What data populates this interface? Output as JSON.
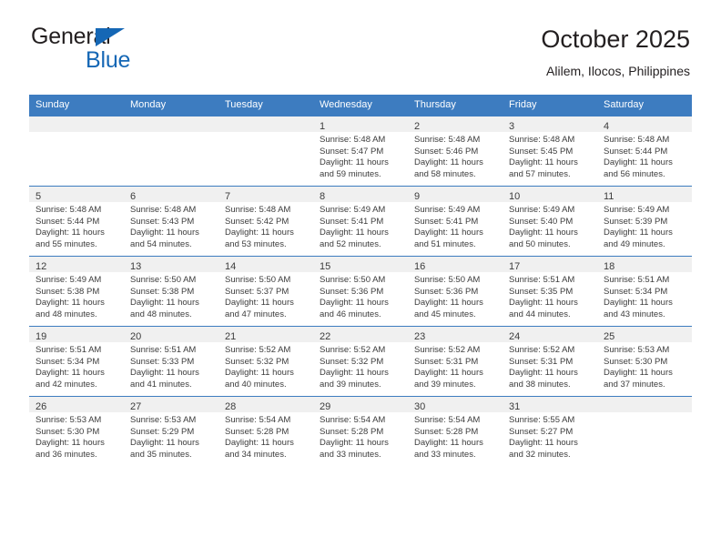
{
  "brand": {
    "name_part1": "General",
    "name_part2": "Blue",
    "triangle_color": "#1567b5"
  },
  "header": {
    "title": "October 2025",
    "subtitle": "Alilem, Ilocos, Philippines"
  },
  "theme": {
    "header_blue": "#3d7cc0",
    "daynum_band": "#f0f0f0",
    "text": "#3c3c3c"
  },
  "calendar": {
    "weekday_headers": [
      "Sunday",
      "Monday",
      "Tuesday",
      "Wednesday",
      "Thursday",
      "Friday",
      "Saturday"
    ],
    "weeks": [
      [
        {
          "day": "",
          "sunrise": "",
          "sunset": "",
          "daylight": "",
          "empty": true
        },
        {
          "day": "",
          "sunrise": "",
          "sunset": "",
          "daylight": "",
          "empty": true
        },
        {
          "day": "",
          "sunrise": "",
          "sunset": "",
          "daylight": "",
          "empty": true
        },
        {
          "day": "1",
          "sunrise": "Sunrise: 5:48 AM",
          "sunset": "Sunset: 5:47 PM",
          "daylight": "Daylight: 11 hours and 59 minutes.",
          "empty": false
        },
        {
          "day": "2",
          "sunrise": "Sunrise: 5:48 AM",
          "sunset": "Sunset: 5:46 PM",
          "daylight": "Daylight: 11 hours and 58 minutes.",
          "empty": false
        },
        {
          "day": "3",
          "sunrise": "Sunrise: 5:48 AM",
          "sunset": "Sunset: 5:45 PM",
          "daylight": "Daylight: 11 hours and 57 minutes.",
          "empty": false
        },
        {
          "day": "4",
          "sunrise": "Sunrise: 5:48 AM",
          "sunset": "Sunset: 5:44 PM",
          "daylight": "Daylight: 11 hours and 56 minutes.",
          "empty": false
        }
      ],
      [
        {
          "day": "5",
          "sunrise": "Sunrise: 5:48 AM",
          "sunset": "Sunset: 5:44 PM",
          "daylight": "Daylight: 11 hours and 55 minutes.",
          "empty": false
        },
        {
          "day": "6",
          "sunrise": "Sunrise: 5:48 AM",
          "sunset": "Sunset: 5:43 PM",
          "daylight": "Daylight: 11 hours and 54 minutes.",
          "empty": false
        },
        {
          "day": "7",
          "sunrise": "Sunrise: 5:48 AM",
          "sunset": "Sunset: 5:42 PM",
          "daylight": "Daylight: 11 hours and 53 minutes.",
          "empty": false
        },
        {
          "day": "8",
          "sunrise": "Sunrise: 5:49 AM",
          "sunset": "Sunset: 5:41 PM",
          "daylight": "Daylight: 11 hours and 52 minutes.",
          "empty": false
        },
        {
          "day": "9",
          "sunrise": "Sunrise: 5:49 AM",
          "sunset": "Sunset: 5:41 PM",
          "daylight": "Daylight: 11 hours and 51 minutes.",
          "empty": false
        },
        {
          "day": "10",
          "sunrise": "Sunrise: 5:49 AM",
          "sunset": "Sunset: 5:40 PM",
          "daylight": "Daylight: 11 hours and 50 minutes.",
          "empty": false
        },
        {
          "day": "11",
          "sunrise": "Sunrise: 5:49 AM",
          "sunset": "Sunset: 5:39 PM",
          "daylight": "Daylight: 11 hours and 49 minutes.",
          "empty": false
        }
      ],
      [
        {
          "day": "12",
          "sunrise": "Sunrise: 5:49 AM",
          "sunset": "Sunset: 5:38 PM",
          "daylight": "Daylight: 11 hours and 48 minutes.",
          "empty": false
        },
        {
          "day": "13",
          "sunrise": "Sunrise: 5:50 AM",
          "sunset": "Sunset: 5:38 PM",
          "daylight": "Daylight: 11 hours and 48 minutes.",
          "empty": false
        },
        {
          "day": "14",
          "sunrise": "Sunrise: 5:50 AM",
          "sunset": "Sunset: 5:37 PM",
          "daylight": "Daylight: 11 hours and 47 minutes.",
          "empty": false
        },
        {
          "day": "15",
          "sunrise": "Sunrise: 5:50 AM",
          "sunset": "Sunset: 5:36 PM",
          "daylight": "Daylight: 11 hours and 46 minutes.",
          "empty": false
        },
        {
          "day": "16",
          "sunrise": "Sunrise: 5:50 AM",
          "sunset": "Sunset: 5:36 PM",
          "daylight": "Daylight: 11 hours and 45 minutes.",
          "empty": false
        },
        {
          "day": "17",
          "sunrise": "Sunrise: 5:51 AM",
          "sunset": "Sunset: 5:35 PM",
          "daylight": "Daylight: 11 hours and 44 minutes.",
          "empty": false
        },
        {
          "day": "18",
          "sunrise": "Sunrise: 5:51 AM",
          "sunset": "Sunset: 5:34 PM",
          "daylight": "Daylight: 11 hours and 43 minutes.",
          "empty": false
        }
      ],
      [
        {
          "day": "19",
          "sunrise": "Sunrise: 5:51 AM",
          "sunset": "Sunset: 5:34 PM",
          "daylight": "Daylight: 11 hours and 42 minutes.",
          "empty": false
        },
        {
          "day": "20",
          "sunrise": "Sunrise: 5:51 AM",
          "sunset": "Sunset: 5:33 PM",
          "daylight": "Daylight: 11 hours and 41 minutes.",
          "empty": false
        },
        {
          "day": "21",
          "sunrise": "Sunrise: 5:52 AM",
          "sunset": "Sunset: 5:32 PM",
          "daylight": "Daylight: 11 hours and 40 minutes.",
          "empty": false
        },
        {
          "day": "22",
          "sunrise": "Sunrise: 5:52 AM",
          "sunset": "Sunset: 5:32 PM",
          "daylight": "Daylight: 11 hours and 39 minutes.",
          "empty": false
        },
        {
          "day": "23",
          "sunrise": "Sunrise: 5:52 AM",
          "sunset": "Sunset: 5:31 PM",
          "daylight": "Daylight: 11 hours and 39 minutes.",
          "empty": false
        },
        {
          "day": "24",
          "sunrise": "Sunrise: 5:52 AM",
          "sunset": "Sunset: 5:31 PM",
          "daylight": "Daylight: 11 hours and 38 minutes.",
          "empty": false
        },
        {
          "day": "25",
          "sunrise": "Sunrise: 5:53 AM",
          "sunset": "Sunset: 5:30 PM",
          "daylight": "Daylight: 11 hours and 37 minutes.",
          "empty": false
        }
      ],
      [
        {
          "day": "26",
          "sunrise": "Sunrise: 5:53 AM",
          "sunset": "Sunset: 5:30 PM",
          "daylight": "Daylight: 11 hours and 36 minutes.",
          "empty": false
        },
        {
          "day": "27",
          "sunrise": "Sunrise: 5:53 AM",
          "sunset": "Sunset: 5:29 PM",
          "daylight": "Daylight: 11 hours and 35 minutes.",
          "empty": false
        },
        {
          "day": "28",
          "sunrise": "Sunrise: 5:54 AM",
          "sunset": "Sunset: 5:28 PM",
          "daylight": "Daylight: 11 hours and 34 minutes.",
          "empty": false
        },
        {
          "day": "29",
          "sunrise": "Sunrise: 5:54 AM",
          "sunset": "Sunset: 5:28 PM",
          "daylight": "Daylight: 11 hours and 33 minutes.",
          "empty": false
        },
        {
          "day": "30",
          "sunrise": "Sunrise: 5:54 AM",
          "sunset": "Sunset: 5:28 PM",
          "daylight": "Daylight: 11 hours and 33 minutes.",
          "empty": false
        },
        {
          "day": "31",
          "sunrise": "Sunrise: 5:55 AM",
          "sunset": "Sunset: 5:27 PM",
          "daylight": "Daylight: 11 hours and 32 minutes.",
          "empty": false
        },
        {
          "day": "",
          "sunrise": "",
          "sunset": "",
          "daylight": "",
          "empty": true
        }
      ]
    ]
  }
}
